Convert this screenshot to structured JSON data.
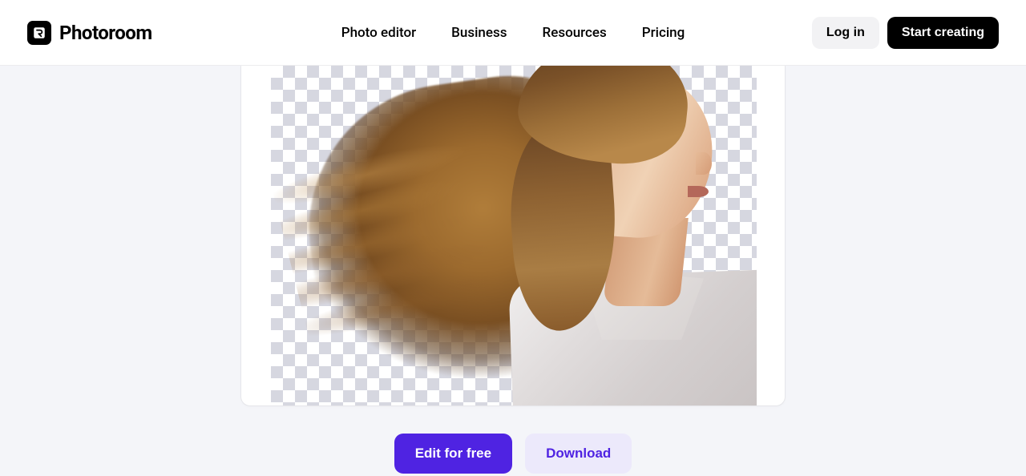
{
  "brand": {
    "name": "Photoroom"
  },
  "nav": {
    "items": [
      {
        "label": "Photo editor"
      },
      {
        "label": "Business"
      },
      {
        "label": "Resources"
      },
      {
        "label": "Pricing"
      }
    ]
  },
  "header": {
    "login_label": "Log in",
    "cta_label": "Start creating"
  },
  "editor": {
    "edit_label": "Edit for free",
    "download_label": "Download"
  },
  "colors": {
    "accent": "#4f23e2",
    "accent_light": "#ece9fb",
    "black": "#000000",
    "page_bg": "#f4f5f9"
  }
}
